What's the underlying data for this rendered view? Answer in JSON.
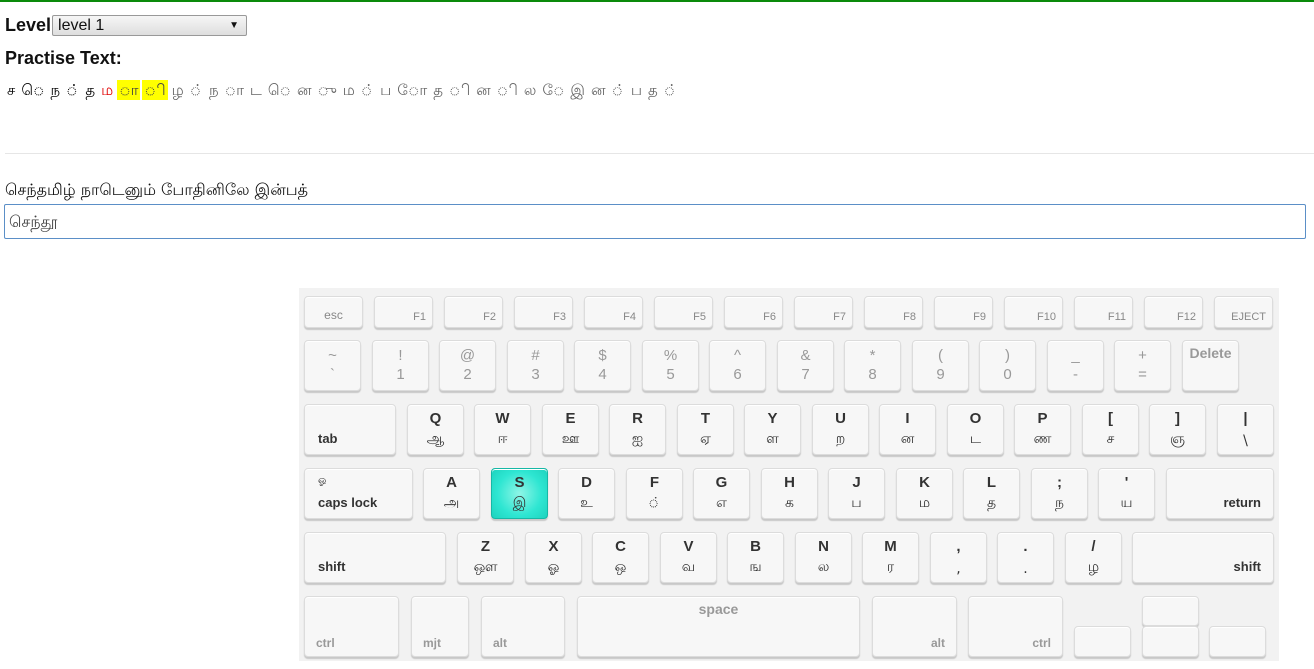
{
  "level": {
    "label": "Level",
    "selected": "level 1"
  },
  "practise": {
    "label": "Practise Text:",
    "chars": [
      {
        "t": "ச",
        "s": "done"
      },
      {
        "t": "ெ",
        "s": "done"
      },
      {
        "t": "ந",
        "s": "done"
      },
      {
        "t": "்",
        "s": "done"
      },
      {
        "t": "த",
        "s": "done"
      },
      {
        "t": "ம",
        "s": "error"
      },
      {
        "t": "ா",
        "s": "current"
      },
      {
        "t": "ி",
        "s": "current"
      },
      {
        "t": "ழ",
        "s": "pending"
      },
      {
        "t": "்",
        "s": "pending"
      },
      {
        "t": "ந",
        "s": "pending"
      },
      {
        "t": "ா",
        "s": "pending"
      },
      {
        "t": "ட",
        "s": "pending"
      },
      {
        "t": "ெ",
        "s": "pending"
      },
      {
        "t": "ன",
        "s": "pending"
      },
      {
        "t": "ு",
        "s": "pending"
      },
      {
        "t": "ம",
        "s": "pending"
      },
      {
        "t": "்",
        "s": "pending"
      },
      {
        "t": "ப",
        "s": "pending"
      },
      {
        "t": "ோ",
        "s": "pending"
      },
      {
        "t": "த",
        "s": "pending"
      },
      {
        "t": "ி",
        "s": "pending"
      },
      {
        "t": "ன",
        "s": "pending"
      },
      {
        "t": "ி",
        "s": "pending"
      },
      {
        "t": "ல",
        "s": "pending"
      },
      {
        "t": "ே",
        "s": "pending"
      },
      {
        "t": "இ",
        "s": "pending"
      },
      {
        "t": "ன",
        "s": "pending"
      },
      {
        "t": "்",
        "s": "pending"
      },
      {
        "t": "ப",
        "s": "pending"
      },
      {
        "t": "த",
        "s": "pending"
      },
      {
        "t": "்",
        "s": "pending"
      }
    ]
  },
  "target_line": "செந்தமிழ் நாடெனும் போதினிலே இன்பத்",
  "typed": "செந்தூ",
  "keyboard": {
    "fn_row": [
      "esc",
      "F1",
      "F2",
      "F3",
      "F4",
      "F5",
      "F6",
      "F7",
      "F8",
      "F9",
      "F10",
      "F11",
      "F12",
      "EJECT"
    ],
    "num_row": [
      {
        "top": "~",
        "bot": "`"
      },
      {
        "top": "!",
        "bot": "1"
      },
      {
        "top": "@",
        "bot": "2"
      },
      {
        "top": "#",
        "bot": "3"
      },
      {
        "top": "$",
        "bot": "4"
      },
      {
        "top": "%",
        "bot": "5"
      },
      {
        "top": "^",
        "bot": "6"
      },
      {
        "top": "&",
        "bot": "7"
      },
      {
        "top": "*",
        "bot": "8"
      },
      {
        "top": "(",
        "bot": "9"
      },
      {
        "top": ")",
        "bot": "0"
      },
      {
        "top": "_",
        "bot": "-"
      },
      {
        "top": "+",
        "bot": "="
      }
    ],
    "delete": "Delete",
    "tab": "tab",
    "q_row": [
      {
        "top": "Q",
        "bot": "ஆ"
      },
      {
        "top": "W",
        "bot": "ஈ"
      },
      {
        "top": "E",
        "bot": "ஊ"
      },
      {
        "top": "R",
        "bot": "ஐ"
      },
      {
        "top": "T",
        "bot": "ஏ"
      },
      {
        "top": "Y",
        "bot": "ள"
      },
      {
        "top": "U",
        "bot": "ற"
      },
      {
        "top": "I",
        "bot": "ன"
      },
      {
        "top": "O",
        "bot": "ட"
      },
      {
        "top": "P",
        "bot": "ண"
      },
      {
        "top": "[",
        "bot": "ச"
      },
      {
        "top": "]",
        "bot": "ஞ"
      },
      {
        "top": "|",
        "bot": "\\"
      }
    ],
    "caps": {
      "top": "ஓ",
      "label": "caps lock"
    },
    "a_row": [
      {
        "top": "A",
        "bot": "அ"
      },
      {
        "top": "S",
        "bot": "இ"
      },
      {
        "top": "D",
        "bot": "உ"
      },
      {
        "top": "F",
        "bot": "்"
      },
      {
        "top": "G",
        "bot": "எ"
      },
      {
        "top": "H",
        "bot": "க"
      },
      {
        "top": "J",
        "bot": "ப"
      },
      {
        "top": "K",
        "bot": "ம"
      },
      {
        "top": "L",
        "bot": "த"
      },
      {
        "top": ";",
        "bot": "ந"
      },
      {
        "top": "'",
        "bot": "ய"
      }
    ],
    "return": "return",
    "shift": "shift",
    "z_row": [
      {
        "top": "Z",
        "bot": "ஔ"
      },
      {
        "top": "X",
        "bot": "ஓ"
      },
      {
        "top": "C",
        "bot": "ஒ"
      },
      {
        "top": "V",
        "bot": "வ"
      },
      {
        "top": "B",
        "bot": "ங"
      },
      {
        "top": "N",
        "bot": "ல"
      },
      {
        "top": "M",
        "bot": "ர"
      },
      {
        "top": ",",
        "bot": ","
      },
      {
        "top": ".",
        "bot": "."
      },
      {
        "top": "/",
        "bot": "ழ"
      }
    ],
    "bottom": {
      "ctrl": "ctrl",
      "mjt": "mjt",
      "alt": "alt",
      "space": "space"
    },
    "highlight_key": "S"
  }
}
